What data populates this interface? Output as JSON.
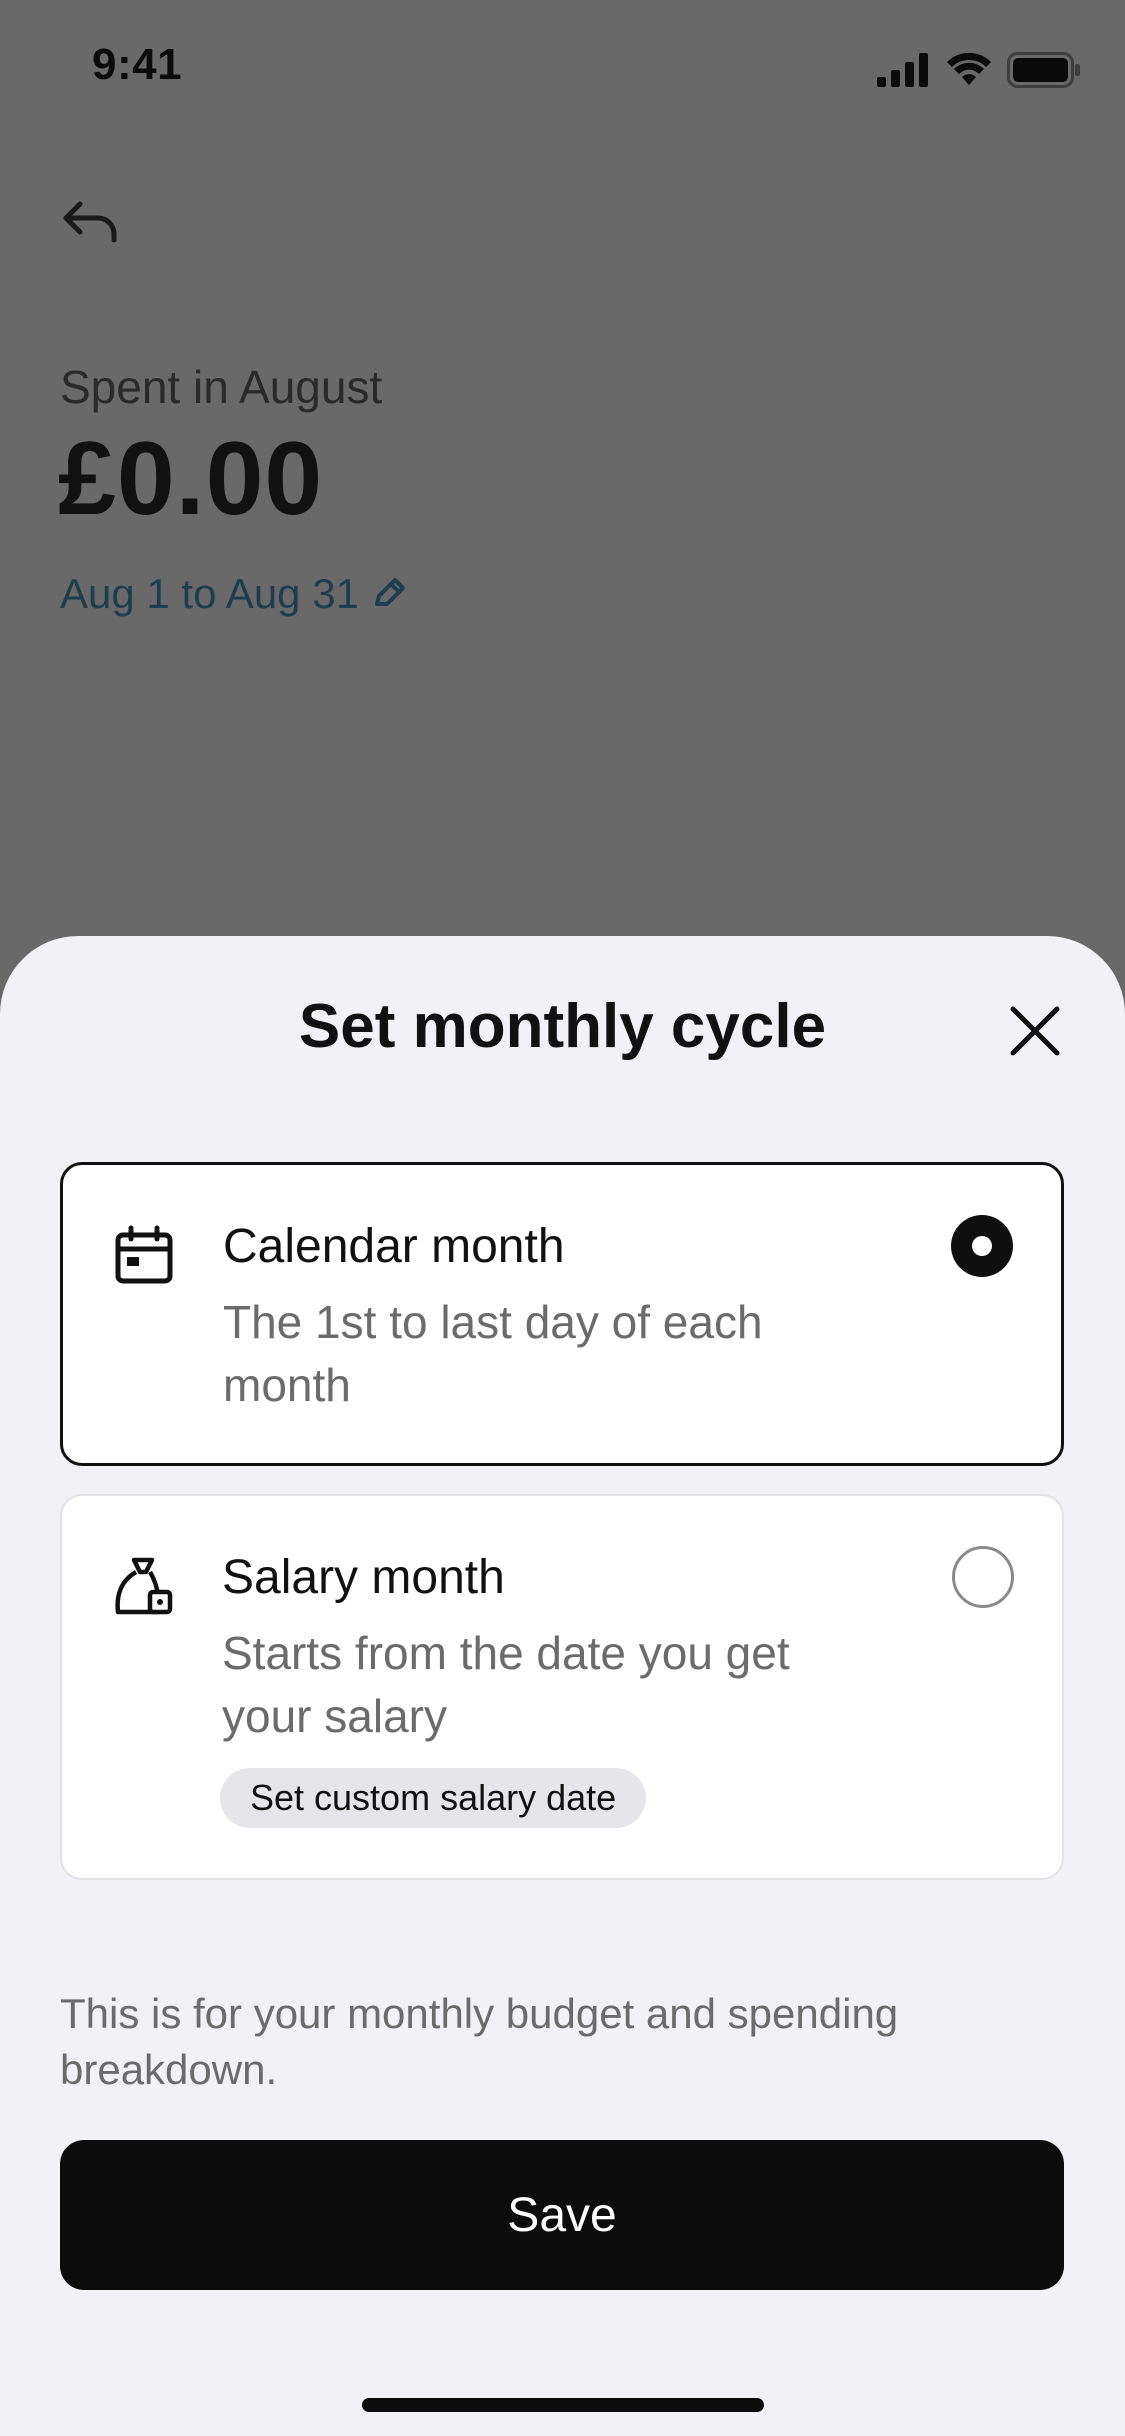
{
  "status_bar": {
    "time": "9:41"
  },
  "background": {
    "spent_label": "Spent in August",
    "amount": "£0.00",
    "date_range": "Aug 1 to Aug 31",
    "icons": [
      "back-arrow-icon",
      "pencil-icon"
    ]
  },
  "sheet": {
    "title": "Set monthly cycle",
    "options": [
      {
        "icon": "calendar-icon",
        "title": "Calendar month",
        "description": "The 1st to last day of each month",
        "selected": true
      },
      {
        "icon": "money-bag-icon",
        "title": "Salary month",
        "description": "Starts from the date you get your salary",
        "chip": "Set custom salary date",
        "selected": false
      }
    ],
    "footnote": "This is for your monthly budget and spending breakdown.",
    "save_label": "Save"
  },
  "colors": {
    "overlay": "#696969",
    "sheet_bg": "#f1f1f6",
    "primary": "#0c0c0c",
    "link": "#1e3e4c"
  }
}
